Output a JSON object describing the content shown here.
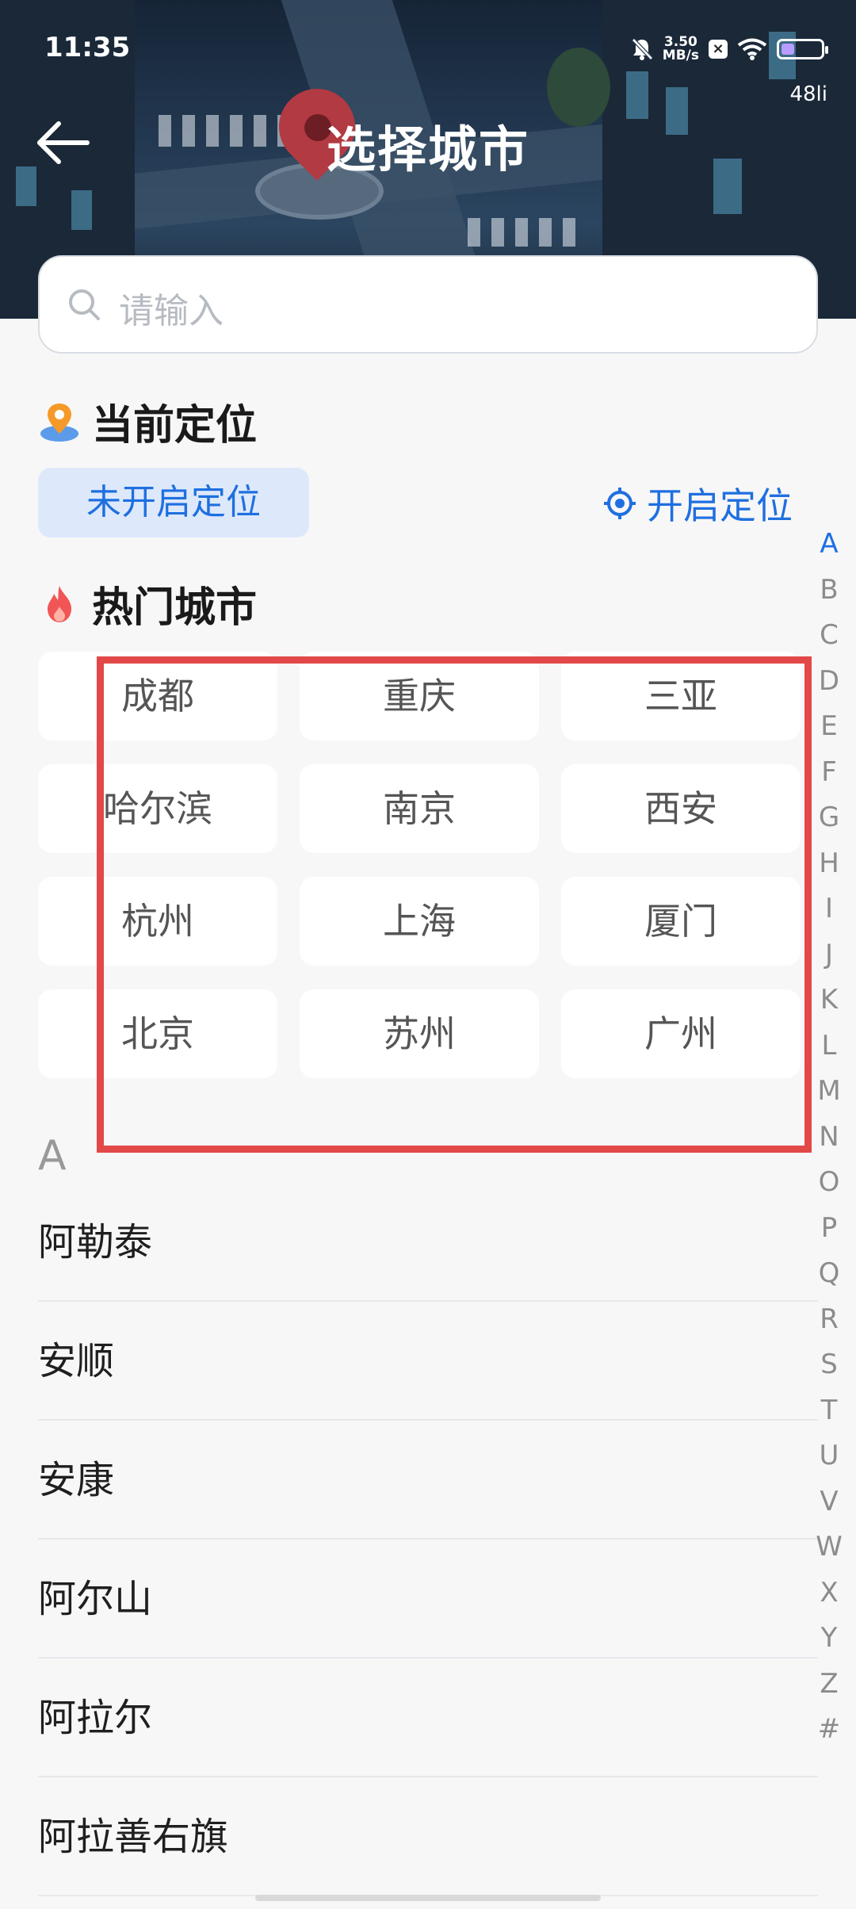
{
  "status_bar": {
    "time": "11:35",
    "net_speed_value": "3.50",
    "net_speed_unit": "MB/s",
    "sub_label": "48li"
  },
  "header": {
    "title": "选择城市"
  },
  "search": {
    "placeholder": "请输入"
  },
  "current_location": {
    "heading": "当前定位",
    "status_chip": "未开启定位",
    "enable_label": "开启定位"
  },
  "hot_cities": {
    "heading": "热门城市",
    "cities": [
      "成都",
      "重庆",
      "三亚",
      "哈尔滨",
      "南京",
      "西安",
      "杭州",
      "上海",
      "厦门",
      "北京",
      "苏州",
      "广州"
    ]
  },
  "city_list": {
    "section_letter": "A",
    "cities": [
      "阿勒泰",
      "安顺",
      "安康",
      "阿尔山",
      "阿拉尔",
      "阿拉善右旗"
    ]
  },
  "alphabet_index": {
    "letters": [
      "A",
      "B",
      "C",
      "D",
      "E",
      "F",
      "G",
      "H",
      "I",
      "J",
      "K",
      "L",
      "M",
      "N",
      "O",
      "P",
      "Q",
      "R",
      "S",
      "T",
      "U",
      "V",
      "W",
      "X",
      "Y",
      "Z",
      "#"
    ],
    "active": "A"
  },
  "colors": {
    "accent": "#1f6fe0",
    "highlight_box": "#e34848",
    "chip_bg": "#dde9fb"
  }
}
